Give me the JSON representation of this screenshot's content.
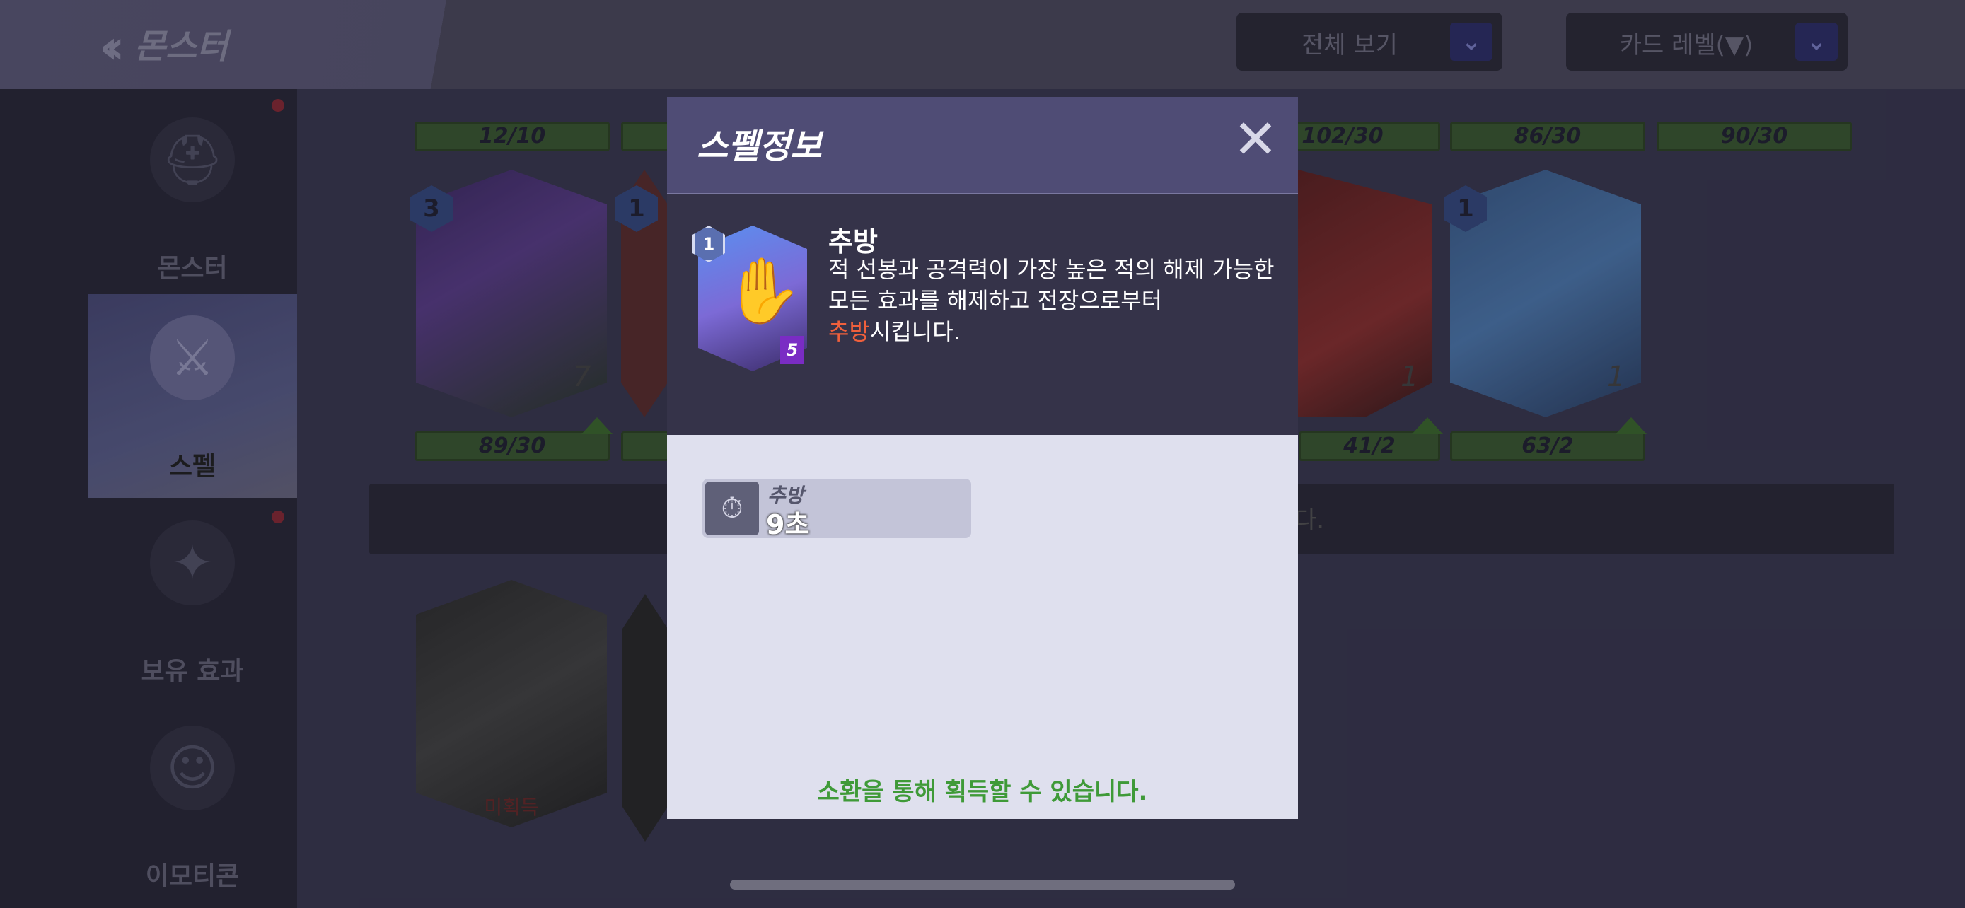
{
  "header": {
    "title": "몬스터",
    "filter_dropdown": "전체 보기",
    "sort_dropdown": "카드 레벨(▼)"
  },
  "sidebar": {
    "items": [
      {
        "label": "몬스터"
      },
      {
        "label": "스펠"
      },
      {
        "label": "보유 효과"
      },
      {
        "label": "이모티콘"
      }
    ]
  },
  "background_grid": {
    "top_bars": [
      "12/10",
      "102/30",
      "86/30",
      "90/30"
    ],
    "cards": [
      {
        "level": "3",
        "count": "7",
        "progress": "89/30"
      },
      {
        "level": "1",
        "count": "",
        "progress": ""
      },
      {
        "level": "",
        "count": "1",
        "progress": "41/2"
      },
      {
        "level": "1",
        "count": "1",
        "progress": "63/2"
      }
    ],
    "locked_label": "미획득",
    "banner_tail": "다."
  },
  "modal": {
    "title": "스펠정보",
    "close_icon": "close-icon",
    "spell": {
      "name": "추방",
      "level": "1",
      "cost": "5",
      "description_line1": "적 선봉과 공격력이 가장 높은 적의 해제 가능한",
      "description_line2": "모든 효과를 해제하고 전장으로부터",
      "description_highlight": "추방",
      "description_line3_tail": "시킵니다."
    },
    "stat": {
      "label": "추방",
      "value": "9초",
      "icon": "timer-icon"
    },
    "acquire_text": "소환을 통해 획득할 수 있습니다."
  },
  "colors": {
    "modal_header": "#4f4c75",
    "highlight": "#f0603c",
    "acquire_text": "#3f9a38"
  }
}
